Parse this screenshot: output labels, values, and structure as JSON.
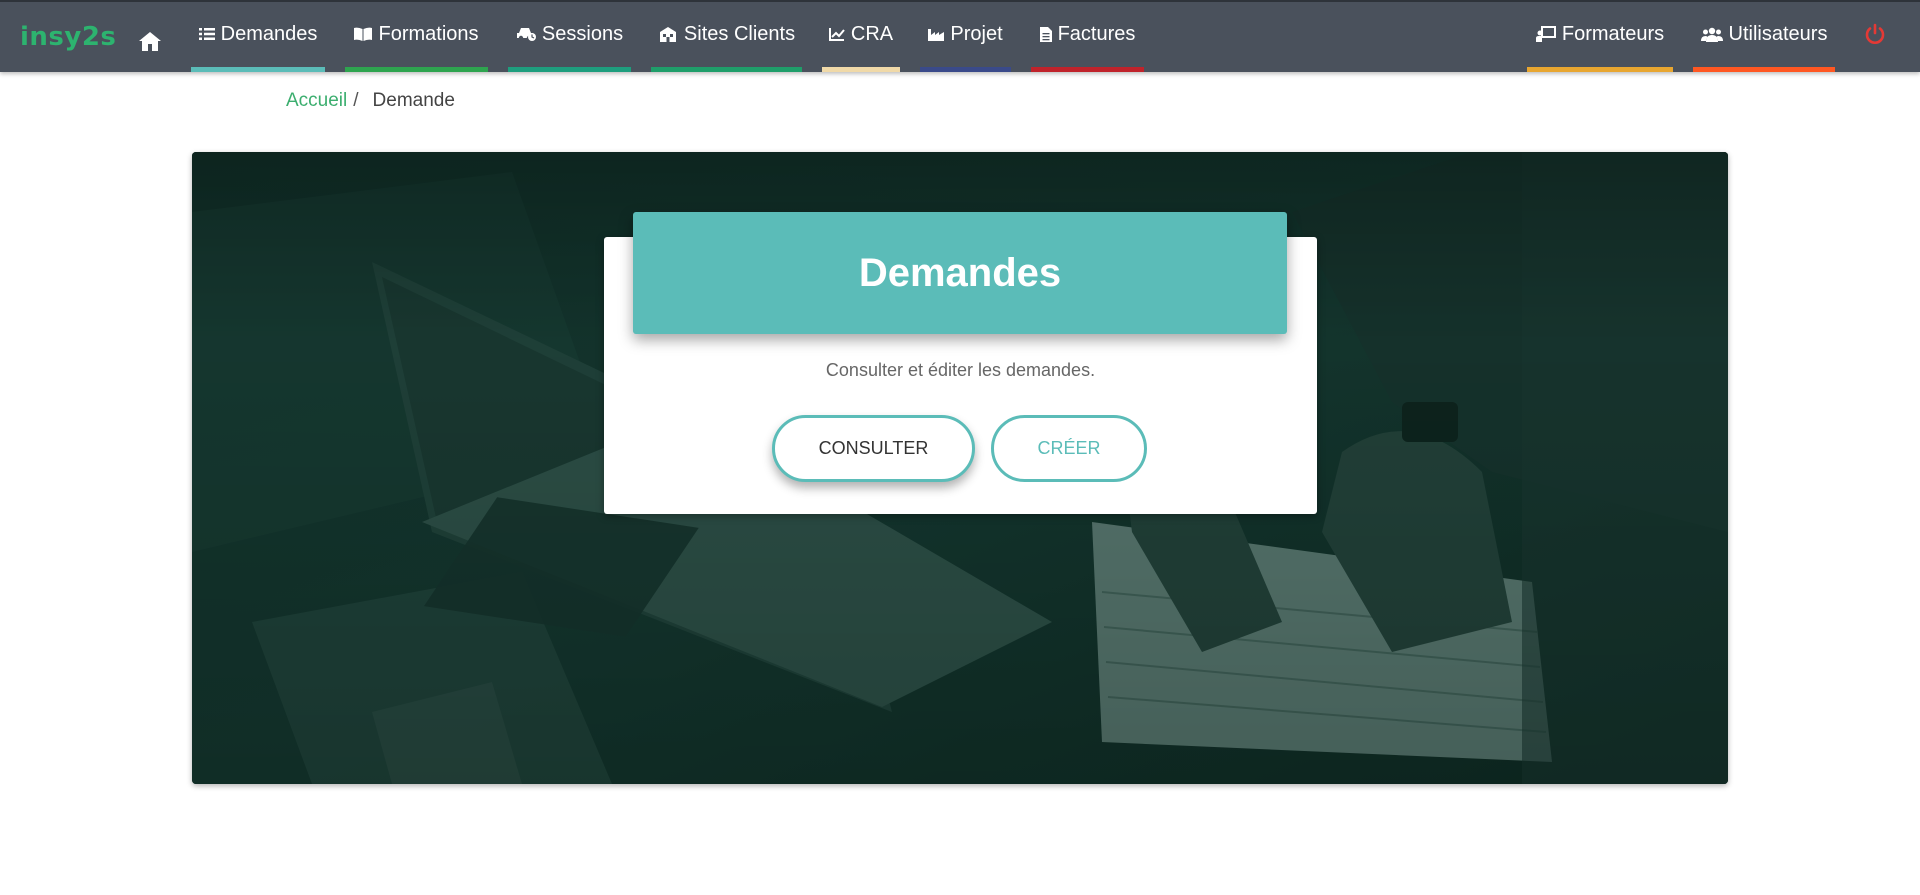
{
  "app": {
    "logo_text": "insy2s"
  },
  "nav": {
    "home_icon": "home-icon",
    "items": [
      {
        "label": "Demandes",
        "icon": "list-icon",
        "color": "#5bbcb8"
      },
      {
        "label": "Formations",
        "icon": "book-icon",
        "color": "#2ea44f"
      },
      {
        "label": "Sessions",
        "icon": "car-icon",
        "color": "#1e9e7e"
      },
      {
        "label": "Sites Clients",
        "icon": "building-icon",
        "color": "#1f9e6a"
      },
      {
        "label": "CRA",
        "icon": "chart-line-icon",
        "color": "#f0d9a8"
      },
      {
        "label": "Projet",
        "icon": "industry-icon",
        "color": "#3a4a8a"
      },
      {
        "label": "Factures",
        "icon": "file-icon",
        "color": "#c0232b"
      }
    ],
    "right_items": [
      {
        "label": "Formateurs",
        "icon": "chalkboard-teacher-icon",
        "color": "#e8a630"
      },
      {
        "label": "Utilisateurs",
        "icon": "users-icon",
        "color": "#ff5722"
      }
    ],
    "power_icon": "power-icon",
    "power_color": "#e53935"
  },
  "breadcrumb": {
    "home": "Accueil",
    "separator": "/",
    "current": "Demande"
  },
  "card": {
    "title": "Demandes",
    "description": "Consulter et éditer les demandes.",
    "primary_button": "CONSULTER",
    "secondary_button": "CRÉER",
    "accent_color": "#5bbcb8"
  }
}
